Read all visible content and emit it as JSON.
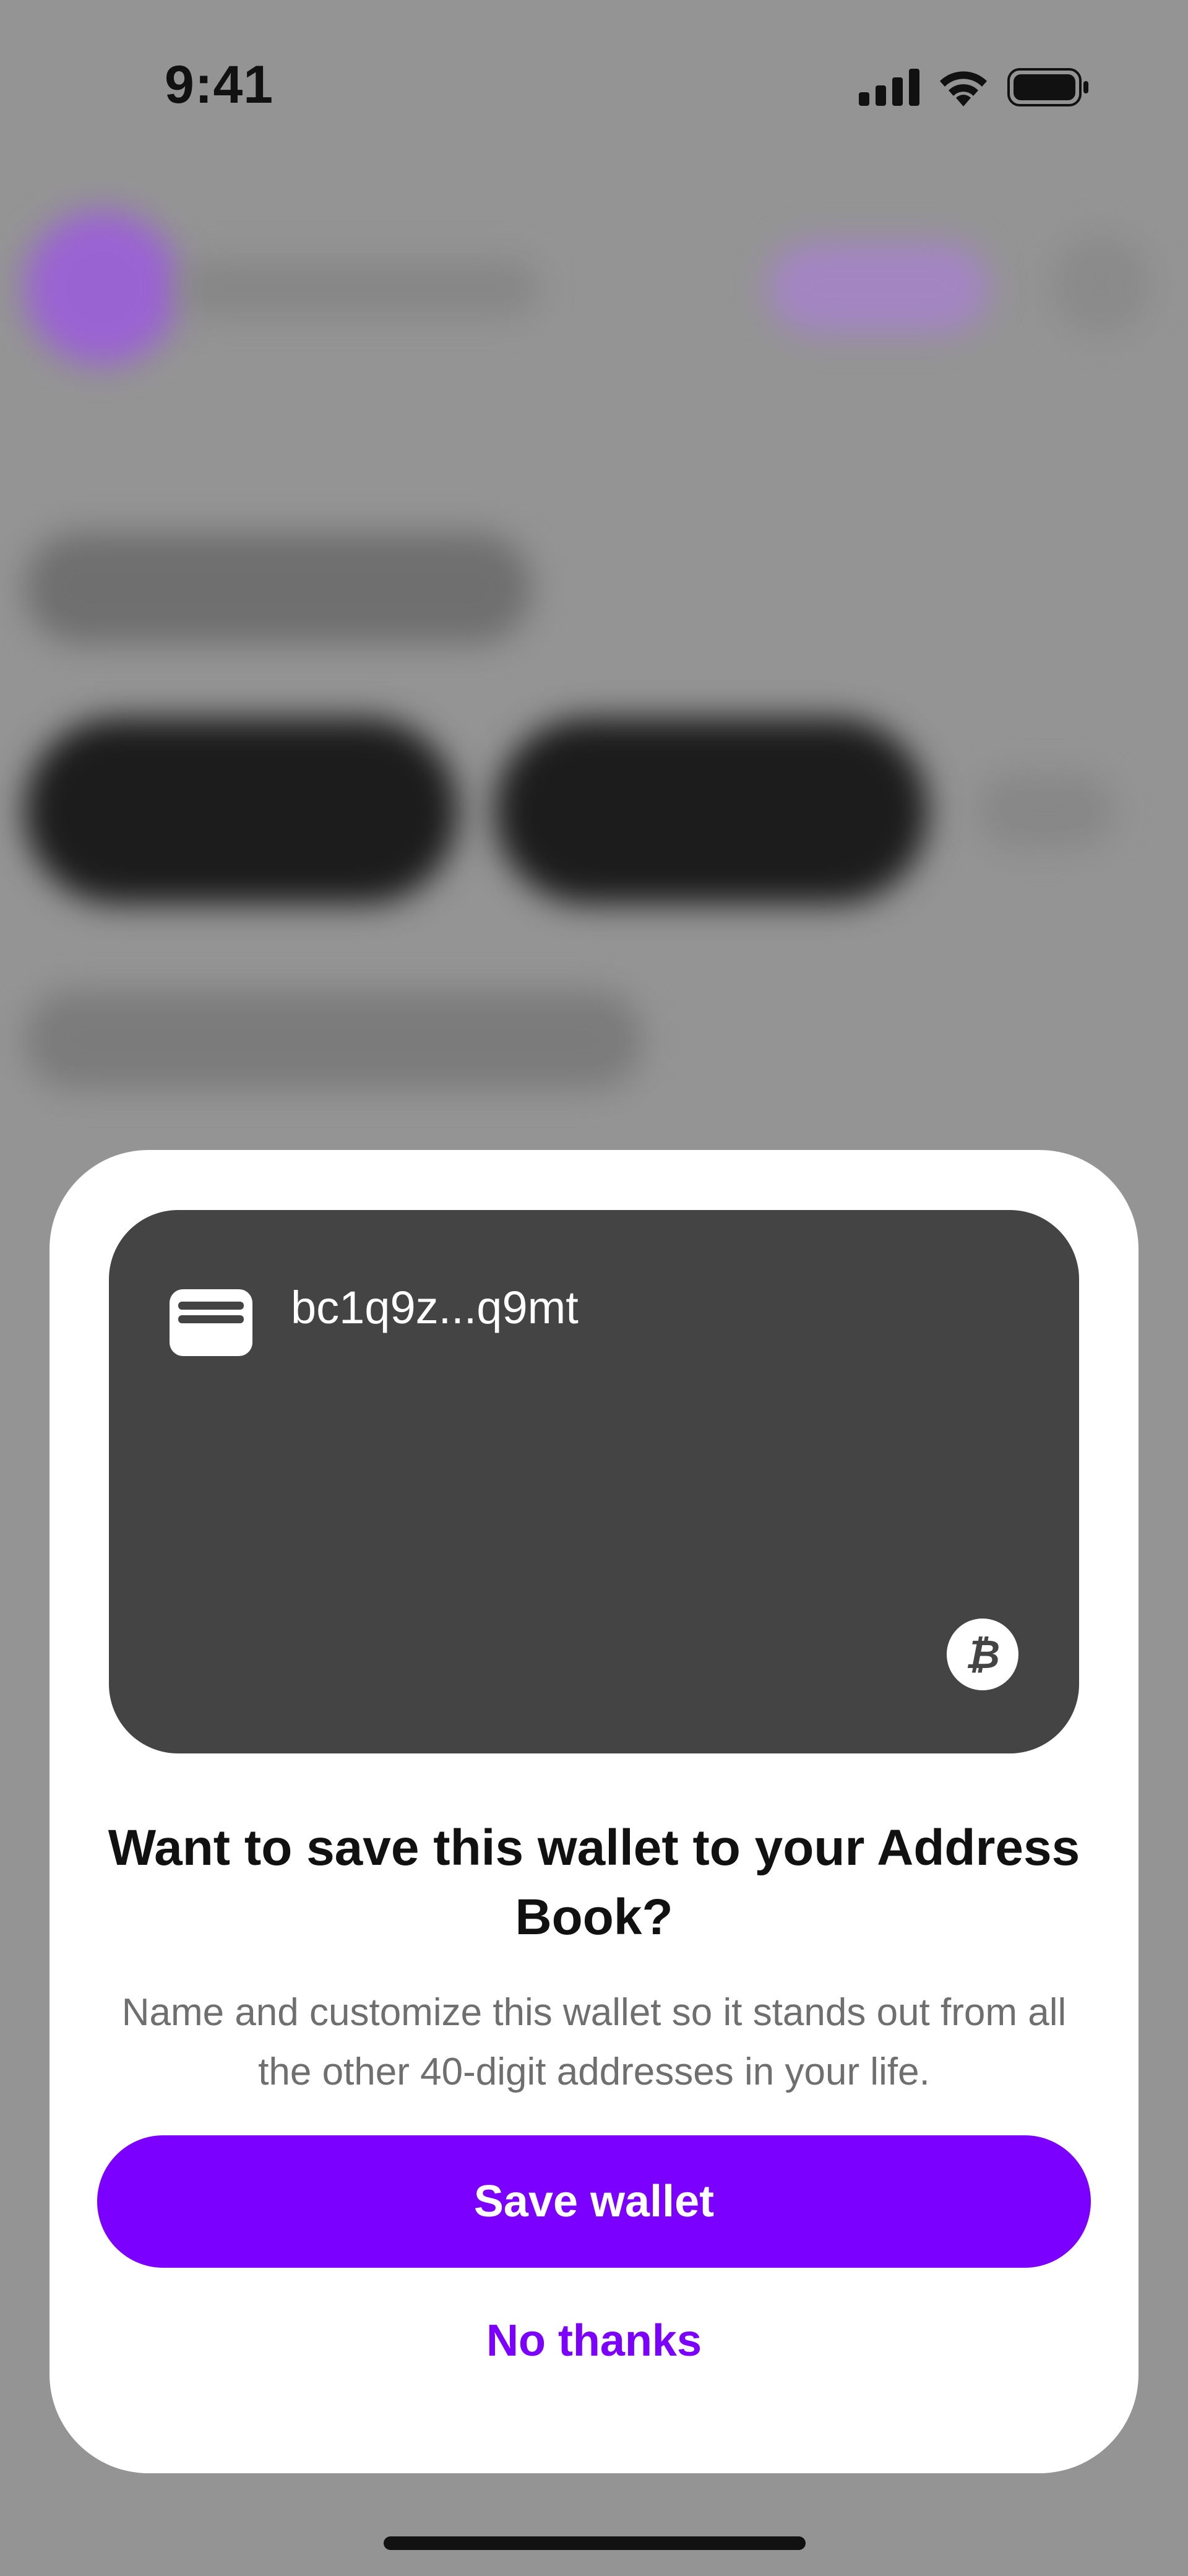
{
  "status_bar": {
    "time": "9:41",
    "icons": [
      "cellular-signal-icon",
      "wifi-icon",
      "battery-icon"
    ]
  },
  "sheet": {
    "wallet_card": {
      "icon": "wallet-card-icon",
      "address": "bc1q9z...q9mt",
      "currency_icon": "bitcoin-icon",
      "currency_symbol": "₿"
    },
    "title": "Want to save this wallet to your Address Book?",
    "description": "Name and customize this wallet so it stands out from all the other 40-digit addresses in your life.",
    "primary_button_label": "Save wallet",
    "secondary_button_label": "No thanks"
  },
  "colors": {
    "accent": "#7b00ff",
    "card_background": "#444444",
    "dimmed_background": "#949494"
  }
}
